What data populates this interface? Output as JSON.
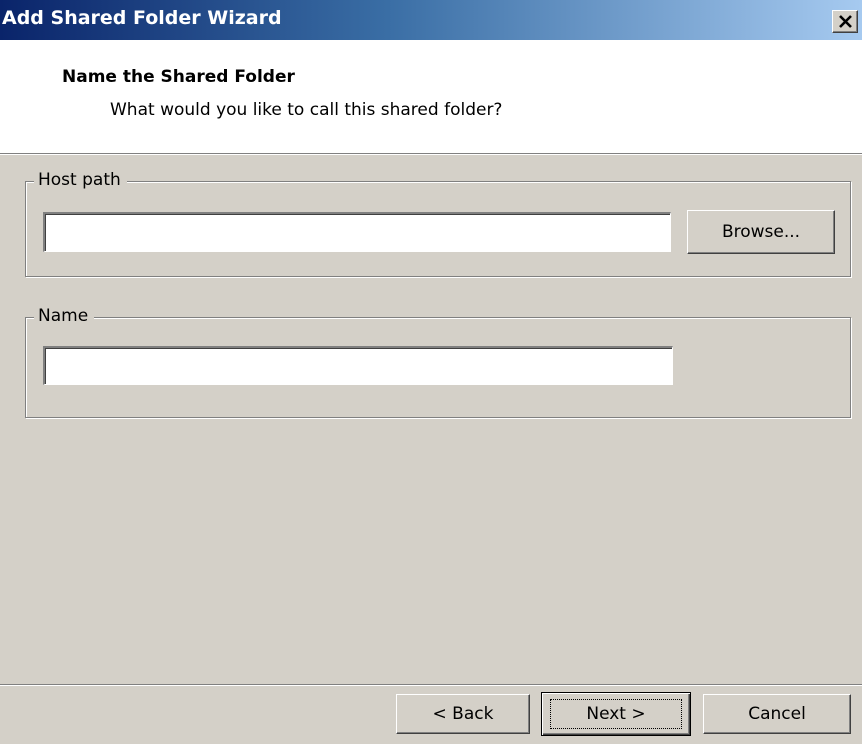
{
  "window": {
    "title": "Add Shared Folder Wizard",
    "close_icon": "close-icon"
  },
  "header": {
    "title": "Name the Shared Folder",
    "subtitle": "What would you like to call this shared folder?"
  },
  "host_path": {
    "label": "Host path",
    "value": "",
    "browse_label": "Browse..."
  },
  "name": {
    "label": "Name",
    "value": ""
  },
  "footer": {
    "back_label": "< Back",
    "next_label": "Next >",
    "cancel_label": "Cancel"
  },
  "colors": {
    "dialog_bg": "#d4d0c8",
    "titlebar_start": "#0a246a",
    "titlebar_end": "#a6caf0"
  }
}
